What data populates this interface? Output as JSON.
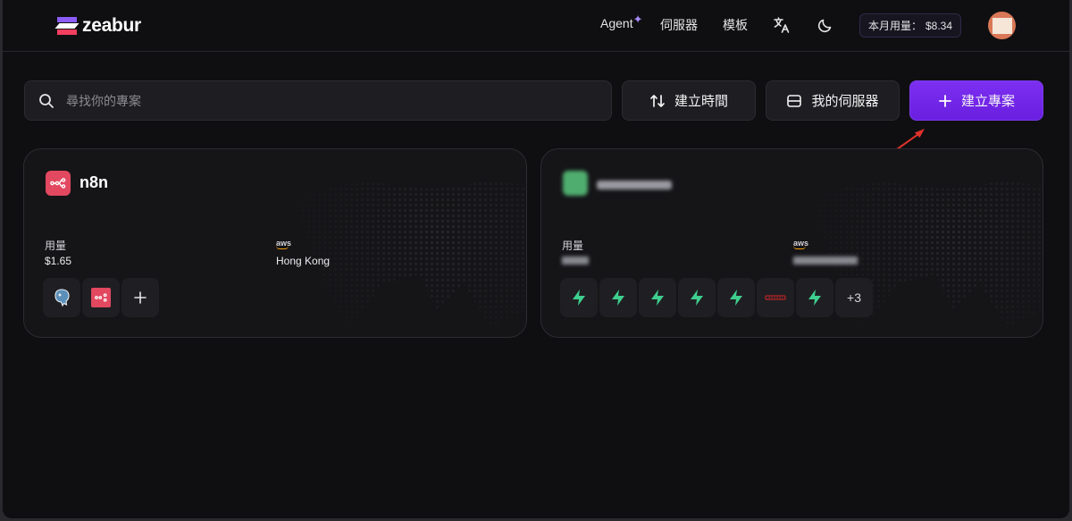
{
  "app": {
    "logo_text": "zeabur",
    "brand_color": "#7c2ff0"
  },
  "header": {
    "nav_agent": "Agent",
    "nav_servers": "伺服器",
    "nav_templates": "模板",
    "usage_label": "本月用量：",
    "usage_value": "$8.34",
    "icons": [
      "translate-icon",
      "moon-icon",
      "avatar"
    ]
  },
  "toolbar": {
    "search_placeholder": "尋找你的專案",
    "sort_label": "建立時間",
    "servers_label": "我的伺服器",
    "create_label": "建立專案"
  },
  "projects": [
    {
      "name": "n8n",
      "usage_label": "用量",
      "usage_value": "$1.65",
      "provider": "aws",
      "region": "Hong Kong",
      "services": [
        "postgresql-icon",
        "n8n-icon",
        "add-icon"
      ]
    },
    {
      "name": "",
      "usage_label": "用量",
      "usage_value": "",
      "provider": "aws",
      "region": "",
      "services": [
        "supabase-icon",
        "supabase-icon",
        "supabase-icon",
        "supabase-icon",
        "supabase-icon",
        "redis-icon",
        "supabase-icon"
      ],
      "more_count": "+3"
    }
  ]
}
